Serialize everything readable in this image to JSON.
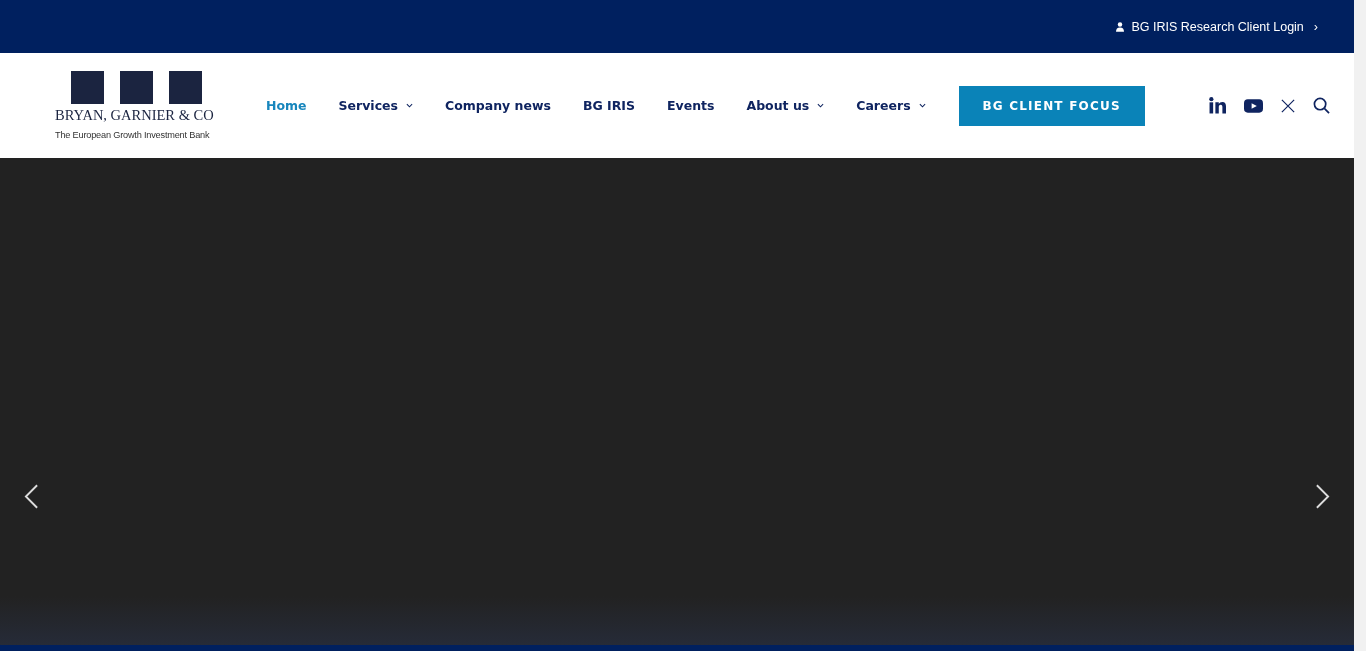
{
  "top_bar": {
    "login_link": "BG IRIS Research Client Login",
    "chevron": "›"
  },
  "logo": {
    "name": "BRYAN, GARNIER & CO",
    "tagline": "The European Growth Investment Bank"
  },
  "nav": [
    {
      "label": "Home",
      "selected": true,
      "has_dropdown": false
    },
    {
      "label": "Services",
      "selected": false,
      "has_dropdown": true
    },
    {
      "label": "Company news",
      "selected": false,
      "has_dropdown": false
    },
    {
      "label": "BG IRIS",
      "selected": false,
      "has_dropdown": false
    },
    {
      "label": "Events",
      "selected": false,
      "has_dropdown": false
    },
    {
      "label": "About us",
      "selected": false,
      "has_dropdown": true
    },
    {
      "label": "Careers",
      "selected": false,
      "has_dropdown": true
    }
  ],
  "cta_button": "BG CLIENT FOCUS",
  "social": [
    {
      "kind": "linkedin"
    },
    {
      "kind": "youtube"
    },
    {
      "kind": "x"
    },
    {
      "kind": "search"
    }
  ]
}
